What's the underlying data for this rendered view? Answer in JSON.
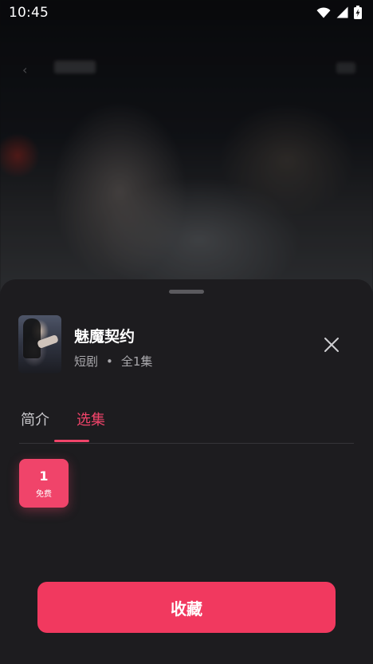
{
  "status_bar": {
    "time": "10:45",
    "icons": [
      "wifi-icon",
      "cell-signal-icon",
      "battery-charging-icon"
    ]
  },
  "sheet": {
    "title": "魅魔契约",
    "genre": "短剧",
    "separator": "•",
    "episode_count": "全1集",
    "tabs": [
      {
        "label": "简介",
        "active": false
      },
      {
        "label": "选集",
        "active": true
      }
    ],
    "episodes": [
      {
        "number": "1",
        "tag": "免费"
      }
    ],
    "collect_label": "收藏"
  },
  "colors": {
    "accent": "#f0446a",
    "sheet_bg": "#1d1c1f",
    "secondary_text": "#a9a8ac"
  }
}
